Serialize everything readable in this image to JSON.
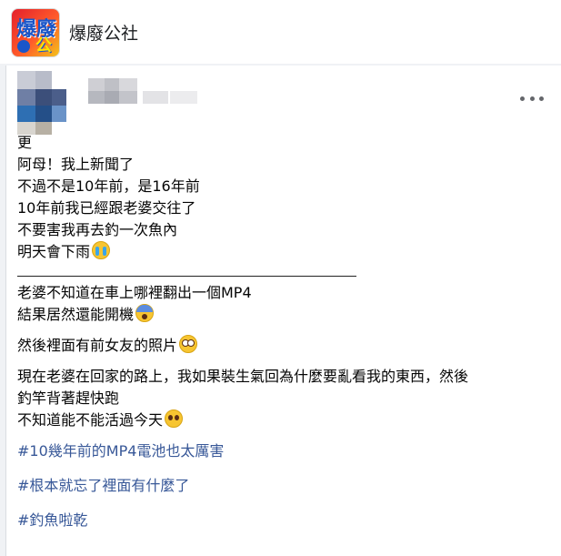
{
  "group": {
    "name": "爆廢公社",
    "logo_text_1": "爆廢",
    "logo_text_2": "公社"
  },
  "post": {
    "lines_a": [
      "更",
      "阿母！我上新聞了",
      "不過不是10年前，是16年前",
      "10年前我已經跟老婆交往了",
      "不要害我再去釣一次魚內"
    ],
    "line_a_last": "明天會下雨",
    "lines_b_1": "老婆不知道在車上哪裡翻出一個MP4",
    "lines_b_2": "結果居然還能開機",
    "line_c": "然後裡面有前女友的照片",
    "line_d_1": "現在老婆在回家的路上，我如果裝生氣回為什麼要亂看我的東西，然後",
    "line_d_2": "釣竿背著趕快跑",
    "line_d_3": "不知道能不能活過今天",
    "hashtags": [
      "#10幾年前的MP4電池也太厲害",
      "#根本就忘了裡面有什麼了",
      "#釣魚啦乾"
    ]
  },
  "emojis": {
    "cry": "loudly-crying-face-icon",
    "scream": "screaming-face-icon",
    "flushed": "flushed-face-icon",
    "plead": "pleading-face-icon"
  },
  "colors": {
    "hashtag": "#385898",
    "page_bg": "#f0f2f5"
  }
}
